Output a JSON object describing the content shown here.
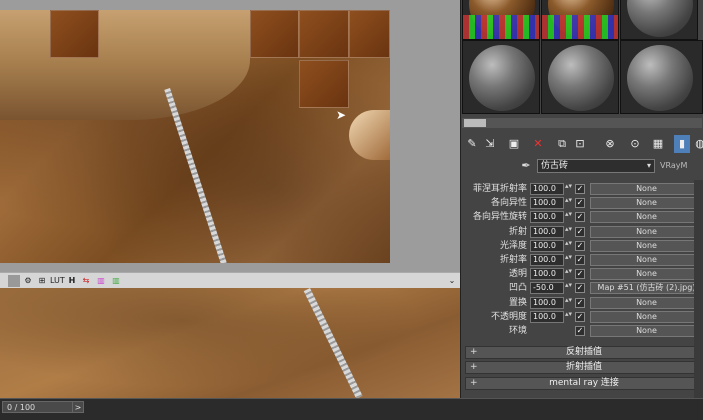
{
  "viewport": {
    "toolbar_icons": [
      "screen-icon",
      "gear-icon",
      "channel-icon",
      "lut-icon",
      "histogram-icon",
      "compare-icon",
      "color-icon",
      "swatch-icon"
    ],
    "toolbar_labels": {
      "lut": "LUT",
      "h": "H"
    },
    "expand_label": "⌄"
  },
  "timeline": {
    "frame": "0 / 100",
    "next": ">"
  },
  "material_editor": {
    "slots": [
      {
        "type": "brown"
      },
      {
        "type": "brown"
      },
      {
        "type": "gray"
      },
      {
        "type": "gray"
      },
      {
        "type": "gray"
      },
      {
        "type": "gray"
      }
    ],
    "name": "仿古砖",
    "type": "VRayM",
    "maps": [
      {
        "label": "菲涅耳折射率",
        "value": "100.0",
        "checked": true,
        "map": "None"
      },
      {
        "label": "各向异性",
        "value": "100.0",
        "checked": true,
        "map": "None"
      },
      {
        "label": "各向异性旋转",
        "value": "100.0",
        "checked": true,
        "map": "None"
      },
      {
        "label": "折射",
        "value": "100.0",
        "checked": true,
        "map": "None"
      },
      {
        "label": "光泽度",
        "value": "100.0",
        "checked": true,
        "map": "None"
      },
      {
        "label": "折射率",
        "value": "100.0",
        "checked": true,
        "map": "None"
      },
      {
        "label": "透明",
        "value": "100.0",
        "checked": true,
        "map": "None"
      },
      {
        "label": "凹凸",
        "value": "-50.0",
        "checked": true,
        "map": "Map #51 (仿古砖 (2).jpg)"
      },
      {
        "label": "置换",
        "value": "100.0",
        "checked": true,
        "map": "None"
      },
      {
        "label": "不透明度",
        "value": "100.0",
        "checked": true,
        "map": "None"
      },
      {
        "label": "环境",
        "value": "",
        "checked": true,
        "map": "None"
      }
    ],
    "rollouts": [
      "反射插值",
      "折射插值",
      "mental ray 连接"
    ]
  }
}
